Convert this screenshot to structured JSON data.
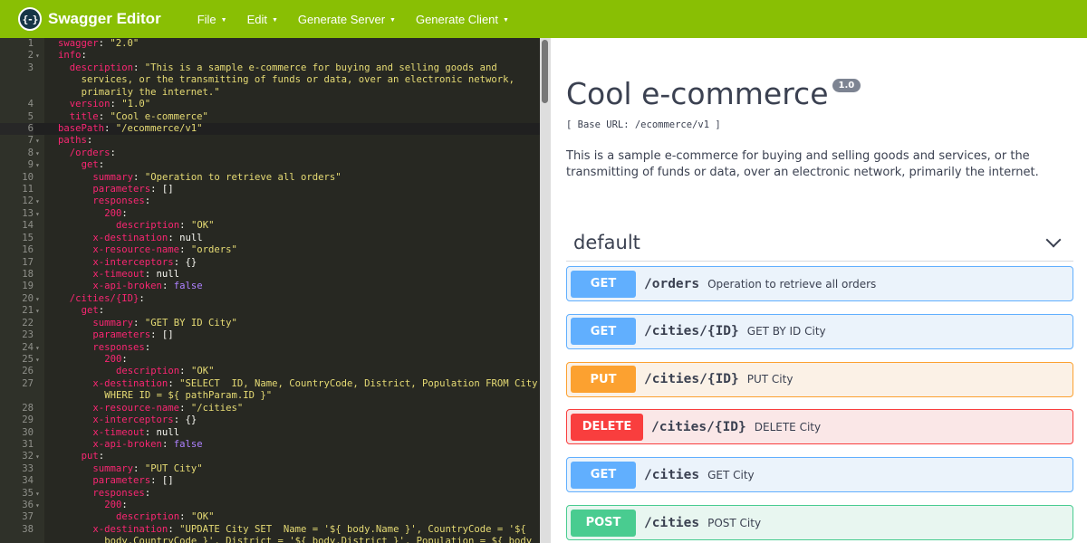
{
  "topbar": {
    "logo_glyph": "{-}",
    "app_name": "Swagger Editor",
    "menu": [
      {
        "label": "File"
      },
      {
        "label": "Edit"
      },
      {
        "label": "Generate Server"
      },
      {
        "label": "Generate Client"
      }
    ],
    "color": "#89bf04"
  },
  "editor": {
    "active_line": 6,
    "lines": [
      {
        "n": "1",
        "fold": false,
        "indent": 0,
        "tokens": [
          [
            "k",
            "swagger"
          ],
          [
            "p",
            ": "
          ],
          [
            "s",
            "\"2.0\""
          ]
        ]
      },
      {
        "n": "2",
        "fold": true,
        "indent": 0,
        "tokens": [
          [
            "k",
            "info"
          ],
          [
            "p",
            ":"
          ]
        ]
      },
      {
        "n": "3",
        "fold": false,
        "indent": 2,
        "tokens": [
          [
            "k",
            "description"
          ],
          [
            "p",
            ": "
          ],
          [
            "s",
            "\"This is a sample e-commerce for buying and selling goods and"
          ]
        ]
      },
      {
        "n": "",
        "fold": false,
        "indent": 4,
        "tokens": [
          [
            "s",
            "services, or the transmitting of funds or data, over an electronic network,"
          ]
        ]
      },
      {
        "n": "",
        "fold": false,
        "indent": 4,
        "tokens": [
          [
            "s",
            "primarily the internet.\""
          ]
        ]
      },
      {
        "n": "4",
        "fold": false,
        "indent": 2,
        "tokens": [
          [
            "k",
            "version"
          ],
          [
            "p",
            ": "
          ],
          [
            "s",
            "\"1.0\""
          ]
        ]
      },
      {
        "n": "5",
        "fold": false,
        "indent": 2,
        "tokens": [
          [
            "k",
            "title"
          ],
          [
            "p",
            ": "
          ],
          [
            "s",
            "\"Cool e-commerce\""
          ]
        ]
      },
      {
        "n": "6",
        "fold": false,
        "indent": 0,
        "tokens": [
          [
            "k",
            "basePath"
          ],
          [
            "p",
            ": "
          ],
          [
            "s",
            "\"/ecommerce/v1\""
          ]
        ]
      },
      {
        "n": "7",
        "fold": true,
        "indent": 0,
        "tokens": [
          [
            "k",
            "paths"
          ],
          [
            "p",
            ":"
          ]
        ]
      },
      {
        "n": "8",
        "fold": true,
        "indent": 2,
        "tokens": [
          [
            "k",
            "/orders"
          ],
          [
            "p",
            ":"
          ]
        ]
      },
      {
        "n": "9",
        "fold": true,
        "indent": 4,
        "tokens": [
          [
            "k",
            "get"
          ],
          [
            "p",
            ":"
          ]
        ]
      },
      {
        "n": "10",
        "fold": false,
        "indent": 6,
        "tokens": [
          [
            "k",
            "summary"
          ],
          [
            "p",
            ": "
          ],
          [
            "s",
            "\"Operation to retrieve all orders\""
          ]
        ]
      },
      {
        "n": "11",
        "fold": false,
        "indent": 6,
        "tokens": [
          [
            "k",
            "parameters"
          ],
          [
            "p",
            ": []"
          ]
        ]
      },
      {
        "n": "12",
        "fold": true,
        "indent": 6,
        "tokens": [
          [
            "k",
            "responses"
          ],
          [
            "p",
            ":"
          ]
        ]
      },
      {
        "n": "13",
        "fold": true,
        "indent": 8,
        "tokens": [
          [
            "k",
            "200"
          ],
          [
            "p",
            ":"
          ]
        ]
      },
      {
        "n": "14",
        "fold": false,
        "indent": 10,
        "tokens": [
          [
            "k",
            "description"
          ],
          [
            "p",
            ": "
          ],
          [
            "s",
            "\"OK\""
          ]
        ]
      },
      {
        "n": "15",
        "fold": false,
        "indent": 6,
        "tokens": [
          [
            "k",
            "x-destination"
          ],
          [
            "p",
            ": null"
          ]
        ]
      },
      {
        "n": "16",
        "fold": false,
        "indent": 6,
        "tokens": [
          [
            "k",
            "x-resource-name"
          ],
          [
            "p",
            ": "
          ],
          [
            "s",
            "\"orders\""
          ]
        ]
      },
      {
        "n": "17",
        "fold": false,
        "indent": 6,
        "tokens": [
          [
            "k",
            "x-interceptors"
          ],
          [
            "p",
            ": {}"
          ]
        ]
      },
      {
        "n": "18",
        "fold": false,
        "indent": 6,
        "tokens": [
          [
            "k",
            "x-timeout"
          ],
          [
            "p",
            ": null"
          ]
        ]
      },
      {
        "n": "19",
        "fold": false,
        "indent": 6,
        "tokens": [
          [
            "k",
            "x-api-broken"
          ],
          [
            "p",
            ": "
          ],
          [
            "n",
            "false"
          ]
        ]
      },
      {
        "n": "20",
        "fold": true,
        "indent": 2,
        "tokens": [
          [
            "k",
            "/cities/{ID}"
          ],
          [
            "p",
            ":"
          ]
        ]
      },
      {
        "n": "21",
        "fold": true,
        "indent": 4,
        "tokens": [
          [
            "k",
            "get"
          ],
          [
            "p",
            ":"
          ]
        ]
      },
      {
        "n": "22",
        "fold": false,
        "indent": 6,
        "tokens": [
          [
            "k",
            "summary"
          ],
          [
            "p",
            ": "
          ],
          [
            "s",
            "\"GET BY ID City\""
          ]
        ]
      },
      {
        "n": "23",
        "fold": false,
        "indent": 6,
        "tokens": [
          [
            "k",
            "parameters"
          ],
          [
            "p",
            ": []"
          ]
        ]
      },
      {
        "n": "24",
        "fold": true,
        "indent": 6,
        "tokens": [
          [
            "k",
            "responses"
          ],
          [
            "p",
            ":"
          ]
        ]
      },
      {
        "n": "25",
        "fold": true,
        "indent": 8,
        "tokens": [
          [
            "k",
            "200"
          ],
          [
            "p",
            ":"
          ]
        ]
      },
      {
        "n": "26",
        "fold": false,
        "indent": 10,
        "tokens": [
          [
            "k",
            "description"
          ],
          [
            "p",
            ": "
          ],
          [
            "s",
            "\"OK\""
          ]
        ]
      },
      {
        "n": "27",
        "fold": false,
        "indent": 6,
        "tokens": [
          [
            "k",
            "x-destination"
          ],
          [
            "p",
            ": "
          ],
          [
            "s",
            "\"SELECT  ID, Name, CountryCode, District, Population FROM City"
          ]
        ]
      },
      {
        "n": "",
        "fold": false,
        "indent": 8,
        "tokens": [
          [
            "s",
            "WHERE ID = ${ pathParam.ID }\""
          ]
        ]
      },
      {
        "n": "28",
        "fold": false,
        "indent": 6,
        "tokens": [
          [
            "k",
            "x-resource-name"
          ],
          [
            "p",
            ": "
          ],
          [
            "s",
            "\"/cities\""
          ]
        ]
      },
      {
        "n": "29",
        "fold": false,
        "indent": 6,
        "tokens": [
          [
            "k",
            "x-interceptors"
          ],
          [
            "p",
            ": {}"
          ]
        ]
      },
      {
        "n": "30",
        "fold": false,
        "indent": 6,
        "tokens": [
          [
            "k",
            "x-timeout"
          ],
          [
            "p",
            ": null"
          ]
        ]
      },
      {
        "n": "31",
        "fold": false,
        "indent": 6,
        "tokens": [
          [
            "k",
            "x-api-broken"
          ],
          [
            "p",
            ": "
          ],
          [
            "n",
            "false"
          ]
        ]
      },
      {
        "n": "32",
        "fold": true,
        "indent": 4,
        "tokens": [
          [
            "k",
            "put"
          ],
          [
            "p",
            ":"
          ]
        ]
      },
      {
        "n": "33",
        "fold": false,
        "indent": 6,
        "tokens": [
          [
            "k",
            "summary"
          ],
          [
            "p",
            ": "
          ],
          [
            "s",
            "\"PUT City\""
          ]
        ]
      },
      {
        "n": "34",
        "fold": false,
        "indent": 6,
        "tokens": [
          [
            "k",
            "parameters"
          ],
          [
            "p",
            ": []"
          ]
        ]
      },
      {
        "n": "35",
        "fold": true,
        "indent": 6,
        "tokens": [
          [
            "k",
            "responses"
          ],
          [
            "p",
            ":"
          ]
        ]
      },
      {
        "n": "36",
        "fold": true,
        "indent": 8,
        "tokens": [
          [
            "k",
            "200"
          ],
          [
            "p",
            ":"
          ]
        ]
      },
      {
        "n": "37",
        "fold": false,
        "indent": 10,
        "tokens": [
          [
            "k",
            "description"
          ],
          [
            "p",
            ": "
          ],
          [
            "s",
            "\"OK\""
          ]
        ]
      },
      {
        "n": "38",
        "fold": false,
        "indent": 6,
        "tokens": [
          [
            "k",
            "x-destination"
          ],
          [
            "p",
            ": "
          ],
          [
            "s",
            "\"UPDATE City SET  Name = '${ body.Name }', CountryCode = '${"
          ]
        ]
      },
      {
        "n": "",
        "fold": false,
        "indent": 8,
        "tokens": [
          [
            "s",
            "body.CountryCode }', District = '${ body.District }', Population = ${ body"
          ]
        ]
      }
    ]
  },
  "preview": {
    "title": "Cool e-commerce",
    "version": "1.0",
    "base_url": "[ Base URL: /ecommerce/v1 ]",
    "description": "This is a sample e-commerce for buying and selling goods and services, or the transmitting of funds or data, over an electronic network, primarily the internet.",
    "section_title": "default",
    "operations": [
      {
        "method": "GET",
        "type": "get",
        "path": "/orders",
        "summary": "Operation to retrieve all orders"
      },
      {
        "method": "GET",
        "type": "get",
        "path": "/cities/{ID}",
        "summary": "GET BY ID City"
      },
      {
        "method": "PUT",
        "type": "put",
        "path": "/cities/{ID}",
        "summary": "PUT City"
      },
      {
        "method": "DELETE",
        "type": "delete",
        "path": "/cities/{ID}",
        "summary": "DELETE City"
      },
      {
        "method": "GET",
        "type": "get",
        "path": "/cities",
        "summary": "GET City"
      },
      {
        "method": "POST",
        "type": "post",
        "path": "/cities",
        "summary": "POST City"
      }
    ]
  }
}
